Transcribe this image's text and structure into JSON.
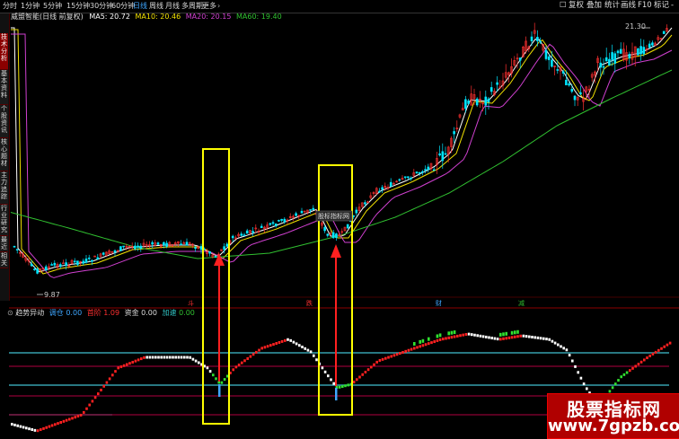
{
  "toolbar": {
    "timeframes": [
      "分时",
      "1分钟",
      "5分钟",
      "15分钟",
      "30分钟",
      "60分钟",
      "日线",
      "周线",
      "月线",
      "多周期",
      "更多"
    ],
    "active_timeframe": "日线",
    "buttons": {
      "restore": "复权",
      "add": "叠加",
      "stats": "统计",
      "draw": "画线",
      "f10": "F10",
      "mark": "标记",
      "more": "-"
    }
  },
  "left_tabs": [
    "技术分析",
    "基本资料",
    "个股资讯",
    "核心题材",
    "主力追踪",
    "行业研究",
    "最近",
    "相关"
  ],
  "main_legend": {
    "title": "威盟智能(日线 前复权)",
    "ma5": "MA5: 20.72",
    "ma10": "MA10: 20.46",
    "ma20": "MA20: 20.15",
    "ma60": "MA60: 19.40"
  },
  "labels": {
    "high_price": "21.30",
    "low_price": "9.87",
    "tooltip": "股标指标网"
  },
  "indicator_legend": {
    "name": "趋势异动",
    "p1_label": "调仓",
    "p1_value": "0.00",
    "p2_label": "首阶",
    "p2_value": "1.09",
    "p3_label": "资金",
    "p3_value": "0.00",
    "p4_label": "加速",
    "p4_value": "0.00"
  },
  "markers": [
    "斗",
    "跌",
    "财",
    "减"
  ],
  "watermark": {
    "line1": "股票指标网",
    "line2": "www.7gpzb.com"
  },
  "colors": {
    "up": "#ff3030",
    "down": "#00e5ff",
    "ma5": "#ffffff",
    "ma10": "#f0e000",
    "ma20": "#d040d0",
    "ma60": "#30c030",
    "box": "#ffff00",
    "arrow": "#ff2020"
  }
}
